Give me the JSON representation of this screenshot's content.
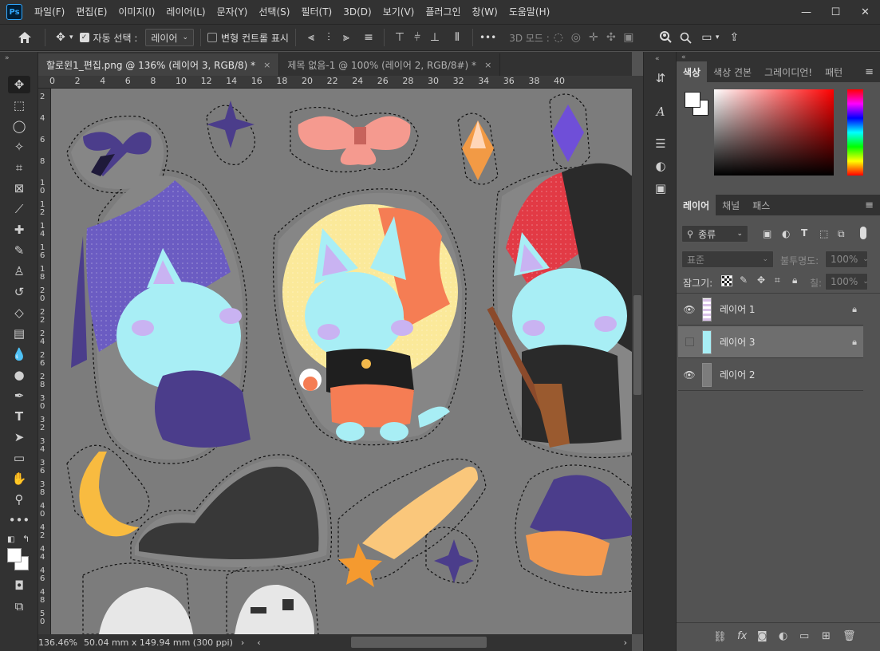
{
  "app": {
    "logo": "Ps"
  },
  "menu": [
    "파일(F)",
    "편집(E)",
    "이미지(I)",
    "레이어(L)",
    "문자(Y)",
    "선택(S)",
    "필터(T)",
    "3D(D)",
    "보기(V)",
    "플러그인",
    "창(W)",
    "도움말(H)"
  ],
  "window_controls": {
    "minimize": "—",
    "restore": "☐",
    "close": "✕"
  },
  "options": {
    "home_icon": "home-icon",
    "auto_select_label": "자동 선택 :",
    "auto_select_checked": true,
    "auto_select_value": "레이어",
    "show_transform_label": "변형 컨트롤 표시",
    "show_transform_checked": false,
    "more": "•••",
    "mode_3d_label": "3D 모드 :"
  },
  "tabs": [
    {
      "label": "할로윈1_편집.png @ 136% (레이어 3, RGB/8) *",
      "close": "×",
      "active": true
    },
    {
      "label": "제목 없음-1 @ 100% (레이어 2, RGB/8#) *",
      "close": "×",
      "active": false
    }
  ],
  "ruler_top": [
    "0",
    "2",
    "4",
    "6",
    "8",
    "10",
    "12",
    "14",
    "16",
    "18",
    "20",
    "22",
    "24",
    "26",
    "28",
    "30",
    "32",
    "34",
    "36",
    "38",
    "40"
  ],
  "ruler_left": [
    "2",
    "4",
    "6",
    "8",
    "1\n0",
    "1\n2",
    "1\n4",
    "1\n6",
    "1\n8",
    "2\n0",
    "2\n2",
    "2\n4",
    "2\n6",
    "2\n8",
    "3\n0",
    "3\n2",
    "3\n4",
    "3\n6",
    "3\n8",
    "4\n0",
    "4\n2",
    "4\n4",
    "4\n6",
    "4\n8",
    "5\n0"
  ],
  "status": {
    "zoom": "136.46%",
    "dimensions": "50.04 mm x 149.94 mm (300 ppi)"
  },
  "color_panel": {
    "tabs": [
      "색상",
      "색상 견본",
      "그레이디언!",
      "패턴"
    ],
    "active_tab": "색상",
    "foreground": "#ffffff",
    "background": "#ffffff",
    "hue_color": "#ff0000"
  },
  "layers_panel": {
    "tabs": [
      "레이어",
      "채널",
      "패스"
    ],
    "active_tab": "레이어",
    "filter_label": "종류",
    "blend_mode": "표준",
    "opacity_label": "불투명도:",
    "opacity_value": "100%",
    "lock_label": "잠그기:",
    "fill_label": "칠:",
    "fill_value": "100%",
    "layers": [
      {
        "name": "레이어 1",
        "visible": true,
        "locked": true,
        "selected": false
      },
      {
        "name": "레이어 3",
        "visible": false,
        "locked": true,
        "selected": true
      },
      {
        "name": "레이어 2",
        "visible": true,
        "locked": false,
        "selected": false
      }
    ]
  }
}
